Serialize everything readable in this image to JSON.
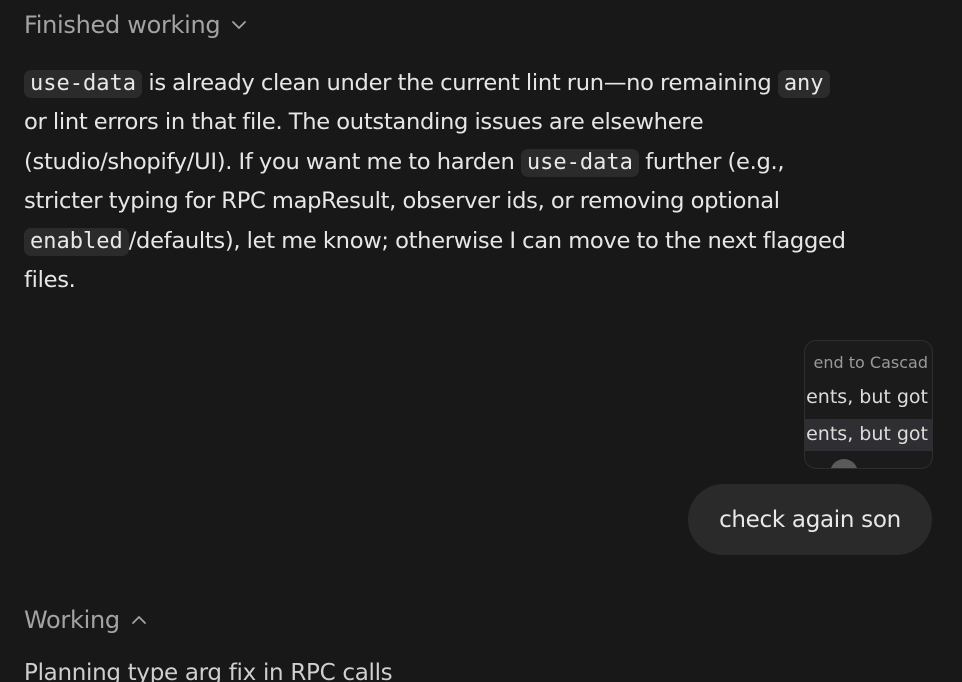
{
  "header_status": {
    "label": "Finished working",
    "icon": "chevron-down-icon"
  },
  "assistant_message": {
    "line1": {
      "code1": "use-data",
      "text1": " is already clean under the current lint run—no remaining ",
      "code2": "any"
    },
    "line2": "or lint errors in that file. The outstanding issues are elsewhere",
    "line3": {
      "text1": "(studio/shopify/UI). If you want me to harden ",
      "code1": "use-data",
      "text2": " further (e.g.,"
    },
    "line4": "stricter typing for RPC mapResult, observer ids, or removing optional",
    "line5": {
      "code1": "enabled",
      "text1": "/defaults), let me know; otherwise I can move to the next flagged"
    },
    "line6": "files."
  },
  "attachment_preview": {
    "line1": "end to Cascad",
    "line2": "ents, but got",
    "line3": "ents, but got"
  },
  "user_message": {
    "text": "check again son"
  },
  "footer_status": {
    "label": "Working",
    "icon": "chevron-up-icon",
    "progress": "Planning type arg fix in RPC calls"
  },
  "colors": {
    "background": "#181818",
    "code_background": "#2b2b2b",
    "bubble_background": "#2a2a2a",
    "muted_text": "#a3a3a3"
  }
}
